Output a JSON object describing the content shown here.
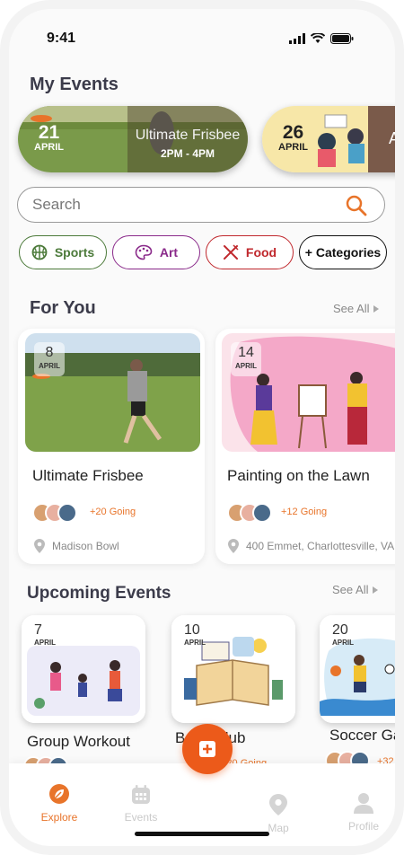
{
  "status_bar": {
    "time": "9:41"
  },
  "my_events": {
    "heading": "My Events",
    "items": [
      {
        "day": "21",
        "month": "APRIL",
        "title": "Ultimate Frisbee",
        "hours": "2PM - 4PM"
      },
      {
        "day": "26",
        "month": "APRIL",
        "title": "A"
      }
    ]
  },
  "search": {
    "placeholder": "Search"
  },
  "chips": [
    {
      "label": "Sports",
      "icon": "basketball-icon"
    },
    {
      "label": "Art",
      "icon": "palette-icon"
    },
    {
      "label": "Food",
      "icon": "fork-knife-icon"
    },
    {
      "label": "+ Categories"
    }
  ],
  "for_you": {
    "heading": "For You",
    "see_all": "See All",
    "cards": [
      {
        "day": "8",
        "month": "APRIL",
        "title": "Ultimate Frisbee",
        "going": "+20 Going",
        "location": "Madison Bowl"
      },
      {
        "day": "14",
        "month": "APRIL",
        "title": "Painting on the Lawn",
        "going": "+12 Going",
        "location": "400 Emmet, Charlottesville, VA"
      }
    ]
  },
  "upcoming": {
    "heading": "Upcoming Events",
    "see_all": "See All",
    "cards": [
      {
        "day": "7",
        "month": "APRIL",
        "title": "Group Workout"
      },
      {
        "day": "10",
        "month": "APRIL",
        "title": "Book Club",
        "going": "+20 Going"
      },
      {
        "day": "20",
        "month": "APRIL",
        "title": "Soccer Ga",
        "going": "+32"
      }
    ]
  },
  "tabs": [
    {
      "label": "Explore",
      "active": true
    },
    {
      "label": "Events"
    },
    {
      "label": "Map"
    },
    {
      "label": "Profile"
    }
  ],
  "colors": {
    "accent": "#e8742a",
    "fab": "#ec5a1a",
    "sports": "#4c7a3a",
    "art": "#8a2a8a",
    "food": "#c0282d"
  }
}
